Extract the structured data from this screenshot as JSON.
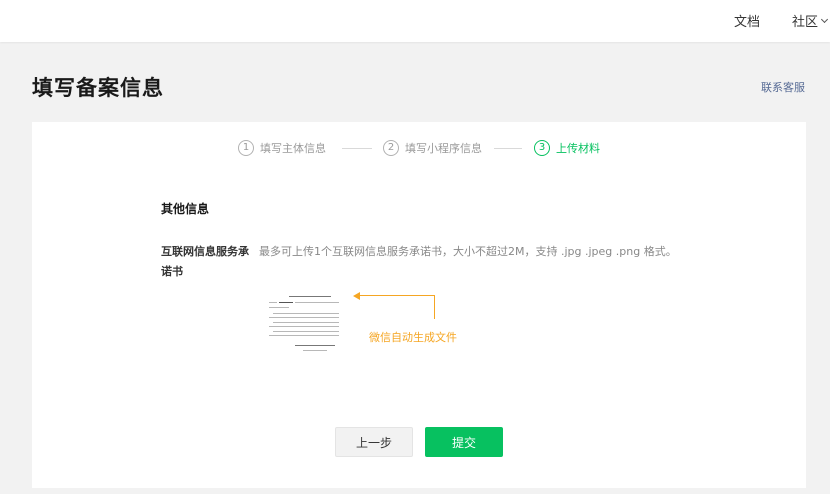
{
  "header": {
    "nav_docs": "文档",
    "nav_community": "社区"
  },
  "page": {
    "title": "填写备案信息",
    "contact_link": "联系客服"
  },
  "steps": [
    {
      "num": "1",
      "label": "填写主体信息",
      "active": false
    },
    {
      "num": "2",
      "label": "填写小程序信息",
      "active": false
    },
    {
      "num": "3",
      "label": "上传材料",
      "active": true
    }
  ],
  "form": {
    "section_heading": "其他信息",
    "field_label": "互联网信息服务承诺书",
    "field_desc": "最多可上传1个互联网信息服务承诺书，大小不超过2M，支持 .jpg .jpeg .png 格式。",
    "annotation": "微信自动生成文件"
  },
  "buttons": {
    "prev": "上一步",
    "submit": "提交"
  },
  "colors": {
    "accent": "#07c160",
    "annotation": "#f5a623",
    "link": "#576b95"
  }
}
